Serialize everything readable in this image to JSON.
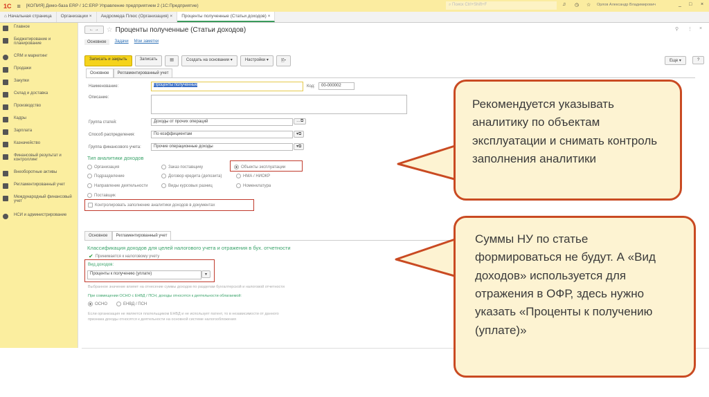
{
  "titlebar": {
    "logo": "1С",
    "title": "[КОПИЯ] Демо-база ERP / 1С:ERP Управление предприятием 2  (1С:Предприятие)",
    "search_placeholder": "Поиск Ctrl+Shift+F",
    "user": "Орлов Александр Владимирович"
  },
  "tabs": [
    {
      "label": "Начальная страница"
    },
    {
      "label": "Организации ×"
    },
    {
      "label": "Андромеда Плюс (Организация) ×"
    },
    {
      "label": "Проценты полученные (Статьи доходов) ×"
    }
  ],
  "sidebar": {
    "items": [
      "Главное",
      "Бюджетирование и планирование",
      "CRM и маркетинг",
      "Продажи",
      "Закупки",
      "Склад и доставка",
      "Производство",
      "Кадры",
      "Зарплата",
      "Казначейство",
      "Финансовый результат и контроллинг",
      "Внеоборотные активы",
      "Регламентированный учет",
      "Международный финансовый учет",
      "НСИ и администрирование"
    ]
  },
  "form": {
    "title": "Проценты полученные (Статьи доходов)",
    "nav_links": [
      "Основное",
      "Задачи",
      "Мои заметки"
    ],
    "toolbar": {
      "save_close": "Записать и закрыть",
      "save": "Записать",
      "create_based": "Создать на основании ▾",
      "settings": "Настройки ▾",
      "more": "Еще ▾",
      "help": "?"
    },
    "tabs": [
      "Основное",
      "Регламентированный учет"
    ],
    "name_label": "Наименование:",
    "name_value": "Проценты полученные",
    "code_label": "Код:",
    "code_value": "00-000002",
    "desc_label": "Описание:",
    "group_label": "Группа статей:",
    "group_value": "Доходы от прочих операций",
    "dist_label": "Способ распределения:",
    "dist_value": "По коэффициентам",
    "fin_label": "Группа финансового учета:",
    "fin_value": "Прочие операционные доходы",
    "analytics_title": "Тип аналитики доходов",
    "analytics": [
      "Организация",
      "Заказ поставщику",
      "Объекты эксплуатации",
      "Подразделение",
      "Договор кредита (депозита)",
      "НМА / НИОКР",
      "Направление деятельности",
      "Виды курсовых разниц",
      "Номенклатура",
      "Поставщик"
    ],
    "control_check": "Контролировать заполнение аналитики доходов в документах"
  },
  "reg": {
    "tabs": [
      "Основное",
      "Регламентированный учет"
    ],
    "heading": "Классификация доходов для целей налогового учета и отражения в бух. отчетности",
    "tax_check": "Принимается к налоговому учету",
    "kind_label": "Вид доходов:",
    "kind_value": "Проценты к получению (уплате)",
    "note1": "Выбранное значение влияет на отнесение суммы доходов по разделам бухгалтерской и налоговой отчетности",
    "combo_label": "При совмещении ОСНО с ЕНВД / ПСН, доходы относятся к деятельности облагаемой:",
    "osno": "ОСНО",
    "envd": "ЕНВД / ПСН",
    "note2": "Если организация не является плательщиком ЕНВД и не использует патент, то в независимости от данного признака доходы относятся к деятельности на основной системе налогообложения"
  },
  "callouts": {
    "first": "Рекомендуется указывать аналитику по объектам эксплуатации и снимать контроль заполнения аналитики",
    "second": "Суммы НУ по статье формироваться не будут. А «Вид доходов» используется для отражения в ОФР, здесь нужно указать «Проценты к получению (уплате)»"
  }
}
